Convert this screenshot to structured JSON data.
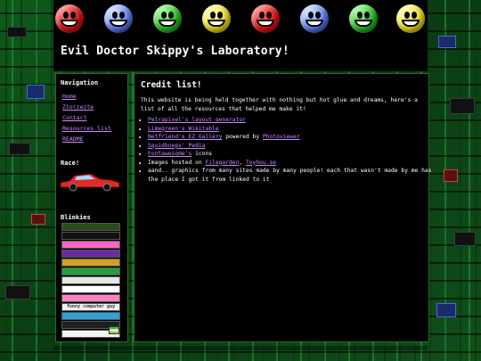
{
  "header": {
    "title": "Evil Doctor Skippy's Laboratory!",
    "faces": [
      "red",
      "blue",
      "green",
      "yellow",
      "red",
      "blue",
      "green",
      "yellow"
    ]
  },
  "sidebar": {
    "nav_heading": "Navigation",
    "nav_items": [
      {
        "label": "Home"
      },
      {
        "label": "Ztorzezte"
      },
      {
        "label": "Contact"
      },
      {
        "label": "Resources list"
      },
      {
        "label": "README"
      }
    ],
    "race_heading": "Race!",
    "blinkies_heading": "Blinkies",
    "blinkies": [
      {
        "label": "",
        "bg": "#2b4a1f",
        "fg": "#ffd000"
      },
      {
        "label": "",
        "bg": "#111111",
        "fg": "#ff3030"
      },
      {
        "label": "",
        "bg": "#ff66c4",
        "fg": "#ffffff"
      },
      {
        "label": "",
        "bg": "#6a2aa0",
        "fg": "#ffffff"
      },
      {
        "label": "",
        "bg": "#d0a020",
        "fg": "#ffffff"
      },
      {
        "label": "",
        "bg": "#20a040",
        "fg": "#ffff80"
      },
      {
        "label": "",
        "bg": "#e6e6e6",
        "fg": "#202020"
      },
      {
        "label": "",
        "bg": "#ffffff",
        "fg": "#c02020"
      },
      {
        "label": "",
        "bg": "#ff80c0",
        "fg": "#ffffff"
      },
      {
        "label": "funny computer guy",
        "bg": "#f0f0f0",
        "fg": "#303030"
      },
      {
        "label": "",
        "bg": "#30a0e0",
        "fg": "#ffffff"
      },
      {
        "label": "",
        "bg": "#202020",
        "fg": "#a0a0a0"
      },
      {
        "label": "",
        "bg": "#f4f4f4",
        "fg": "#303030"
      }
    ]
  },
  "main": {
    "heading": "Credit list!",
    "intro": "This website is being held together with nothing but hot glue and dreams, here's a list of all the resources that helped me make it!",
    "credits": [
      {
        "parts": [
          {
            "text": "Petrapixel's layout generator",
            "link": true
          }
        ]
      },
      {
        "parts": [
          {
            "text": "Limegreen's Wikitable",
            "link": true
          }
        ]
      },
      {
        "parts": [
          {
            "text": "Netfriend's EZ Gallery",
            "link": true
          },
          {
            "text": " powered by ",
            "link": false
          },
          {
            "text": "Photoviewer",
            "link": true
          }
        ]
      },
      {
        "parts": [
          {
            "text": "Squidkneps' Pedia",
            "link": true
          }
        ]
      },
      {
        "parts": [
          {
            "text": "Fontawesome's",
            "link": true
          },
          {
            "text": " icons",
            "link": false
          }
        ]
      },
      {
        "parts": [
          {
            "text": "Images hosted on ",
            "link": false
          },
          {
            "text": "Filegarden",
            "link": true
          },
          {
            "text": ", ",
            "link": false
          },
          {
            "text": "Toyhou.se",
            "link": true
          }
        ]
      },
      {
        "parts": [
          {
            "text": "aand.. graphics from many sites made by many people! each that wasn't made by me has the place I got it from linked to it",
            "link": false
          }
        ]
      }
    ]
  },
  "colors": {
    "link": "#cc88ff",
    "panel": "#000000",
    "text": "#ffffff"
  }
}
